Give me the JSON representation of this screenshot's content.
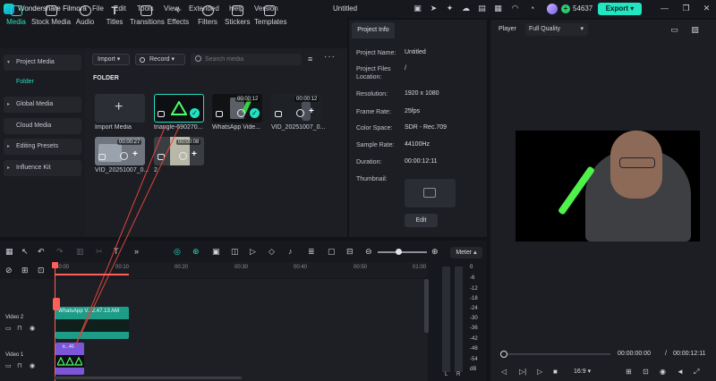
{
  "app": {
    "name": "Wondershare Filmora",
    "document_title": "Untitled",
    "credits": "54637",
    "export_label": "Export"
  },
  "menu": [
    "File",
    "Edit",
    "Tools",
    "View",
    "Extended",
    "Help",
    "Version"
  ],
  "toolbar": {
    "items": [
      {
        "label": "Media",
        "icon": "media-icon",
        "active": true
      },
      {
        "label": "Stock Media",
        "icon": "stock-media-icon"
      },
      {
        "label": "Audio",
        "icon": "audio-icon"
      },
      {
        "label": "Titles",
        "icon": "titles-icon"
      },
      {
        "label": "Transitions",
        "icon": "transitions-icon"
      },
      {
        "label": "Effects",
        "icon": "effects-icon"
      },
      {
        "label": "Filters",
        "icon": "filters-icon"
      },
      {
        "label": "Stickers",
        "icon": "stickers-icon"
      },
      {
        "label": "Templates",
        "icon": "templates-icon"
      }
    ]
  },
  "sidebar": {
    "items": [
      {
        "label": "Project Media"
      },
      {
        "label": "Global Media"
      },
      {
        "label": "Cloud Media"
      },
      {
        "label": "Editing Presets"
      },
      {
        "label": "Influence Kit"
      }
    ],
    "folder_label": "Folder"
  },
  "media": {
    "import_label": "Import",
    "record_label": "Record",
    "search_placeholder": "Search media",
    "folder_heading": "FOLDER",
    "items": [
      {
        "label": "Import Media",
        "duration": ""
      },
      {
        "label": "triangle-690270...",
        "duration": ""
      },
      {
        "label": "WhatsApp Vide...",
        "duration": "00:00:12"
      },
      {
        "label": "VID_20251007_0...",
        "duration": "00:00:12"
      },
      {
        "label": "VID_20251007_0...",
        "duration": "00:00:27"
      },
      {
        "label": "2",
        "duration": "00:00:08"
      }
    ]
  },
  "project_info": {
    "tab_label": "Project Info",
    "fields": [
      {
        "key": "Project Name:",
        "value": "Untitled"
      },
      {
        "key": "Project Files Location:",
        "value": "/"
      },
      {
        "key": "Resolution:",
        "value": "1920 x 1080"
      },
      {
        "key": "Frame Rate:",
        "value": "25fps"
      },
      {
        "key": "Color Space:",
        "value": "SDR - Rec.709"
      },
      {
        "key": "Sample Rate:",
        "value": "44100Hz"
      },
      {
        "key": "Duration:",
        "value": "00:00:12:11"
      },
      {
        "key": "Thumbnail:",
        "value": ""
      }
    ],
    "edit_label": "Edit"
  },
  "player": {
    "label": "Player",
    "quality": "Full Quality",
    "time_current": "00:00:00:00",
    "time_separator": "/",
    "time_total": "00:00:12:11",
    "aspect_ratio": "16:9",
    "progress": 0
  },
  "timeline": {
    "meter_label": "Meter",
    "ruler_ticks": [
      "00:00",
      "00:10",
      "00:20",
      "00:30",
      "00:40",
      "00:50",
      "01:00"
    ],
    "tracks": [
      {
        "name": "Video 2"
      },
      {
        "name": "Video 1"
      }
    ],
    "clip_video2_label": "WhatsApp V...2.47.13 AM",
    "clip_video1_label": "tr...40",
    "zoom_level": 0.4,
    "meter_ticks": [
      "0",
      "-6",
      "-12",
      "-18",
      "-24",
      "-30",
      "-36",
      "-42",
      "-48",
      "-54",
      "dB"
    ],
    "meter_channels": [
      "L",
      "R"
    ]
  },
  "colors": {
    "accent": "#23e0c0",
    "background": "#121317",
    "panel": "#1c1e23",
    "clip_video": "#1d9c88",
    "clip_overlay": "#7c56d8",
    "playhead": "#ff5f57"
  }
}
